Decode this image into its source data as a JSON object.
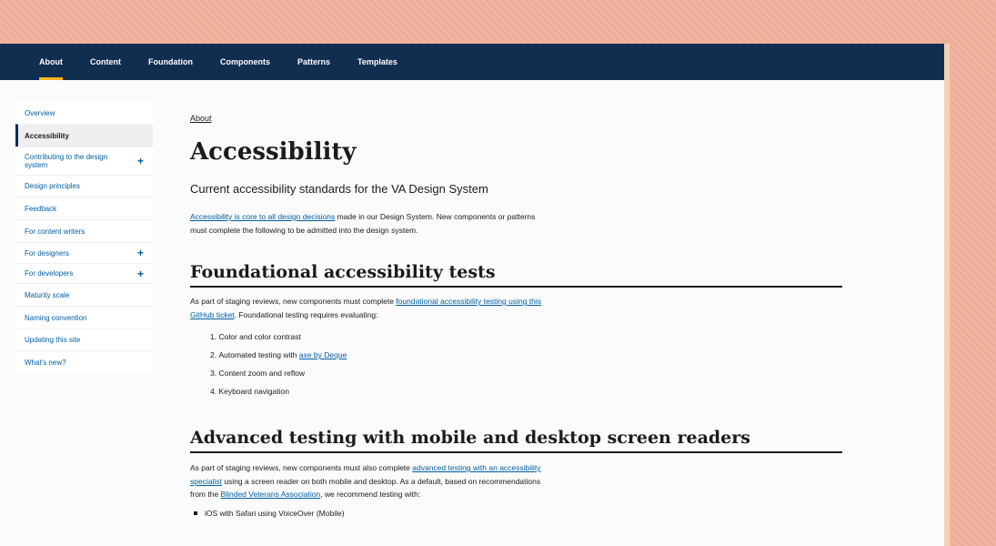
{
  "topnav": {
    "items": [
      {
        "label": "About",
        "active": true
      },
      {
        "label": "Content",
        "active": false
      },
      {
        "label": "Foundation",
        "active": false
      },
      {
        "label": "Components",
        "active": false
      },
      {
        "label": "Patterns",
        "active": false
      },
      {
        "label": "Templates",
        "active": false
      }
    ]
  },
  "sidebar": {
    "items": [
      {
        "label": "Overview",
        "expandable": false
      },
      {
        "label": "Accessibility",
        "active": true,
        "expandable": false
      },
      {
        "label": "Contributing to the design system",
        "expandable": true
      },
      {
        "label": "Design principles",
        "expandable": false
      },
      {
        "label": "Feedback",
        "expandable": false
      },
      {
        "label": "For content writers",
        "expandable": false
      },
      {
        "label": "For designers",
        "expandable": true
      },
      {
        "label": "For developers",
        "expandable": true
      },
      {
        "label": "Maturity scale",
        "expandable": false
      },
      {
        "label": "Naming convention",
        "expandable": false
      },
      {
        "label": "Updating this site",
        "expandable": false
      },
      {
        "label": "What's new?",
        "expandable": false
      }
    ],
    "plus_glyph": "+"
  },
  "main": {
    "breadcrumb": "About",
    "title": "Accessibility",
    "lead": "Current accessibility standards for the VA Design System",
    "intro": {
      "link": "Accessibility is core to all design decisions",
      "text": " made in our Design System. New components or patterns must complete the following to be admitted into the design system."
    },
    "section1": {
      "heading": "Foundational accessibility tests",
      "para_before": "As part of staging reviews, new components must complete ",
      "para_link": "foundational accessibility testing using this GitHub ticket",
      "para_after": ". Foundational testing requires evaluating:",
      "items": [
        {
          "num": "1.",
          "text": "Color and color contrast"
        },
        {
          "num": "2.",
          "text": "Automated testing with ",
          "link": "axe by Deque"
        },
        {
          "num": "3.",
          "text": "Content zoom and reflow"
        },
        {
          "num": "4.",
          "text": "Keyboard navigation"
        }
      ]
    },
    "section2": {
      "heading": "Advanced testing with mobile and desktop screen readers",
      "para_before": "As part of staging reviews, new components must also complete ",
      "para_link1": "advanced testing with an accessibility specialist",
      "para_mid": " using a screen reader on both mobile and desktop. As a default, based on recommendations from the ",
      "para_link2": "Blinded Veterans Association",
      "para_after": ", we recommend testing with:",
      "bullets": [
        "iOS with Safari using VoiceOver (Mobile)"
      ]
    }
  },
  "colors": {
    "nav_bg": "#112e51",
    "nav_active_underline": "#fdb81e",
    "link": "#005ea2",
    "text": "#1b1b1b",
    "backdrop": "#f2b09c"
  }
}
